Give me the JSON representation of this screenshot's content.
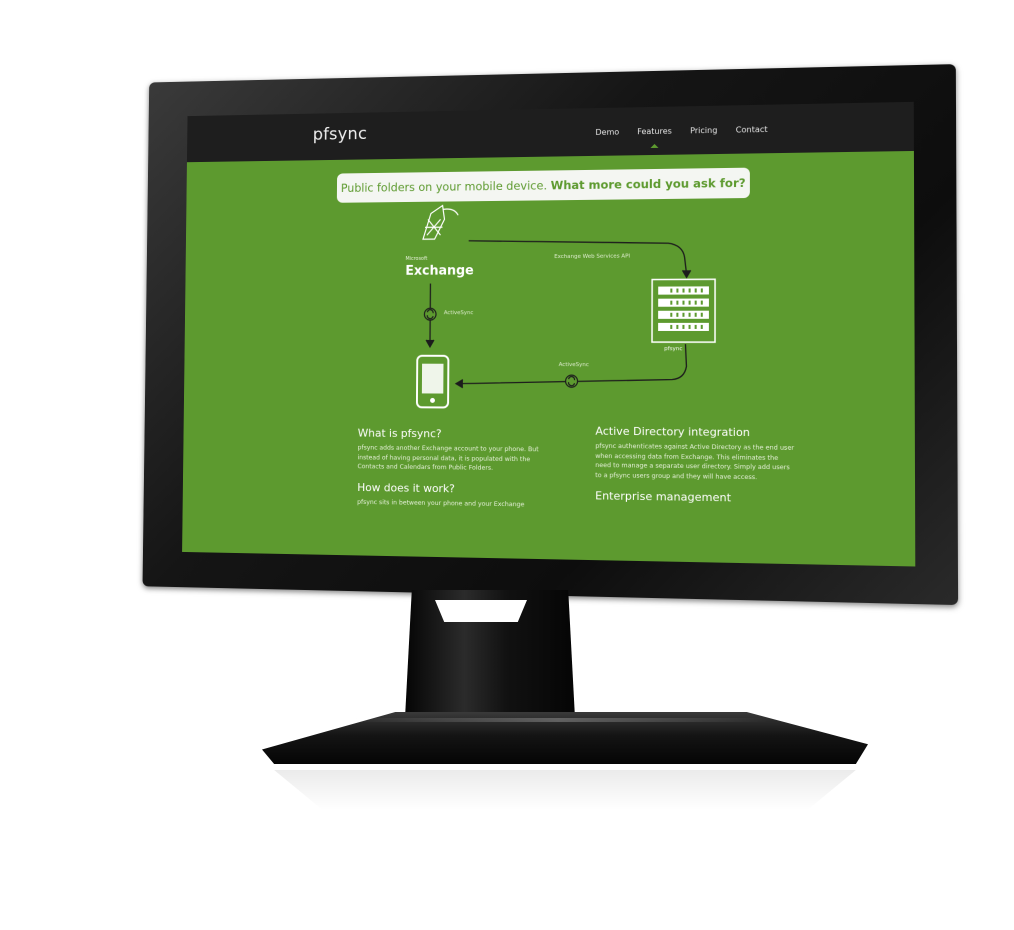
{
  "site": {
    "brand": "pfsync",
    "nav": [
      {
        "label": "Demo",
        "active": false
      },
      {
        "label": "Features",
        "active": true
      },
      {
        "label": "Pricing",
        "active": false
      },
      {
        "label": "Contact",
        "active": false
      }
    ],
    "tagline_regular": "Public folders on your mobile device.",
    "tagline_bold": "What more could you ask for?"
  },
  "diagram": {
    "exchange_small": "Microsoft",
    "exchange_label": "Exchange",
    "ews_label": "Exchange Web Services API",
    "activesync_left": "ActiveSync",
    "activesync_bottom": "ActiveSync",
    "server_label": "pfsync"
  },
  "content": {
    "what_title": "What is pfsync?",
    "what_body": "pfsync adds another Exchange account to your phone. But instead of having personal data, it is populated with the Contacts and Calendars from Public Folders.",
    "how_title": "How does it work?",
    "how_body": "pfsync sits in between your phone and your Exchange",
    "ad_title": "Active Directory integration",
    "ad_body": "pfsync authenticates against Active Directory as the end user when accessing data from Exchange. This eliminates the need to manage a separate user directory. Simply add users to a pfsync users group and they will have access.",
    "ent_title": "Enterprise management"
  },
  "colors": {
    "screen_green": "#5d9a2f",
    "header_dark": "#1e1e1e",
    "bezel": "#151515"
  }
}
